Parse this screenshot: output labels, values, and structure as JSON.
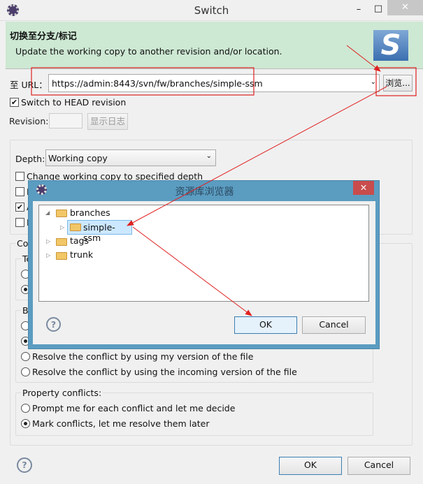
{
  "window": {
    "title": "Switch",
    "minimize": "–",
    "maximize": "□",
    "close": "✕"
  },
  "banner": {
    "heading": "切换至分支/标记",
    "description": "Update the working copy to another revision and/or location."
  },
  "url": {
    "label": "至 URL：",
    "value": "https://admin:8443/svn/fw/branches/simple-ssm",
    "browse_label": "浏览..."
  },
  "switch_head": {
    "label": "Switch to HEAD revision",
    "checked": true
  },
  "revision": {
    "label": "Revision:",
    "value": "",
    "show_log_label": "显示日志"
  },
  "depth": {
    "label": "Depth:",
    "value": "Working copy"
  },
  "options": [
    {
      "label": "Change working copy to specified depth",
      "checked": false
    },
    {
      "label": "I",
      "checked": false
    },
    {
      "label": "A",
      "checked": true
    },
    {
      "label": "I",
      "checked": false
    }
  ],
  "conflicts": {
    "group_label": "Co",
    "text_label": "Te",
    "binary_label": "Bi",
    "binary_options": [
      "Resolve the conflict by using my version of the file",
      "Resolve the conflict by using the incoming version of the file"
    ]
  },
  "property_conflicts": {
    "label": "Property conflicts:",
    "options": [
      {
        "label": "Prompt me for each conflict and let me decide",
        "selected": false
      },
      {
        "label": "Mark conflicts, let me resolve them later",
        "selected": true
      }
    ]
  },
  "footer": {
    "ok": "OK",
    "cancel": "Cancel"
  },
  "repo_browser": {
    "title": "资源库浏览器",
    "close": "✕",
    "tree": [
      {
        "label": "branches",
        "expanded": true,
        "children": [
          {
            "label": "simple-ssm",
            "selected": true
          }
        ]
      },
      {
        "label": "tags"
      },
      {
        "label": "trunk"
      }
    ],
    "ok": "OK",
    "cancel": "Cancel"
  },
  "colors": {
    "banner": "#cde8d3",
    "dialog_frame": "#5b9cc1",
    "annotation": "#e02020",
    "selection": "#cce8ff"
  }
}
